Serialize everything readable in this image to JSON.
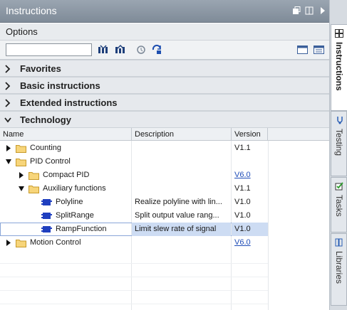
{
  "titlebar": {
    "title": "Instructions"
  },
  "options": {
    "label": "Options",
    "search_value": ""
  },
  "palettes": [
    {
      "label": "Favorites",
      "expanded": false
    },
    {
      "label": "Basic instructions",
      "expanded": false
    },
    {
      "label": "Extended instructions",
      "expanded": false
    },
    {
      "label": "Technology",
      "expanded": true
    }
  ],
  "columns": {
    "name": "Name",
    "description": "Description",
    "version": "Version"
  },
  "tree": [
    {
      "name": "Counting",
      "description": "",
      "version": "V1.1",
      "version_link": false,
      "icon": "folder-icon",
      "expanded": false
    },
    {
      "name": "PID Control",
      "description": "",
      "version": "",
      "version_link": false,
      "icon": "folder-icon",
      "expanded": true
    },
    {
      "name": "Compact PID",
      "description": "",
      "version": "V6.0",
      "version_link": true,
      "icon": "folder-icon",
      "expanded": false
    },
    {
      "name": "Auxiliary functions",
      "description": "",
      "version": "V1.1",
      "version_link": false,
      "icon": "folder-icon",
      "expanded": true
    },
    {
      "name": "Polyline",
      "description": "Realize polyline with lin...",
      "version": "V1.0",
      "version_link": false,
      "icon": "function-block-icon"
    },
    {
      "name": "SplitRange",
      "description": "Split output value rang...",
      "version": "V1.0",
      "version_link": false,
      "icon": "function-block-icon"
    },
    {
      "name": "RampFunction",
      "description": "Limit slew rate of signal",
      "version": "V1.0",
      "version_link": false,
      "icon": "function-block-icon",
      "selected": true
    },
    {
      "name": "Motion Control",
      "description": "",
      "version": "V6.0",
      "version_link": true,
      "icon": "folder-icon",
      "expanded": false
    }
  ],
  "side_tabs": [
    {
      "label": "Instructions",
      "active": true
    },
    {
      "label": "Testing",
      "active": false
    },
    {
      "label": "Tasks",
      "active": false
    },
    {
      "label": "Libraries",
      "active": false
    }
  ]
}
